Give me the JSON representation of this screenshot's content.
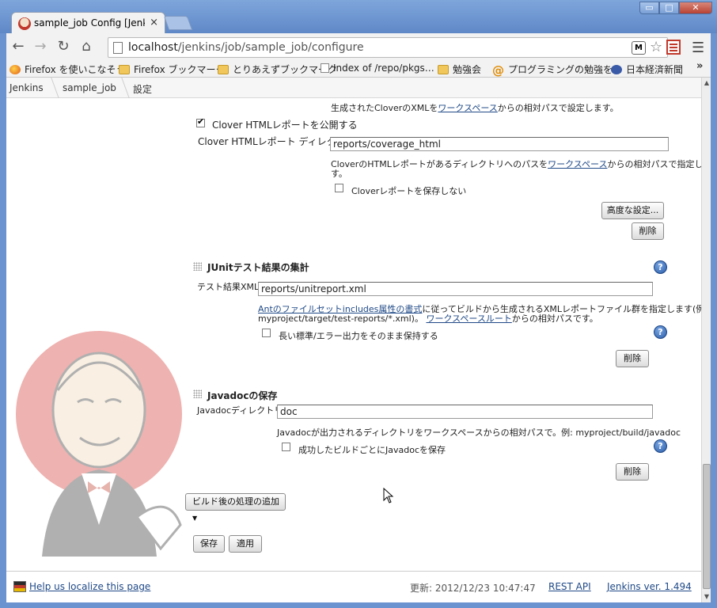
{
  "browser": {
    "tab_title": "sample_job Config [Jenkins]",
    "tab_close": "×",
    "url_prefix": "localhost",
    "url_path": "/jenkins/job/sample_job/configure",
    "ext_icon": "M",
    "back_icon": "←",
    "forward_icon": "→",
    "reload_icon": "↻",
    "home_icon": "⌂",
    "star_icon": "☆",
    "menu_icon": "☰",
    "window_min": "▭",
    "window_max": "□",
    "window_close": "✕",
    "bookmarks_more": "»",
    "bookmarks": [
      {
        "label": "Firefox を使いこなそう",
        "icon": "firefox-icon"
      },
      {
        "label": "Firefox ブックマーク",
        "icon": "folder-icon"
      },
      {
        "label": "とりあえずブックマーク",
        "icon": "folder-icon"
      },
      {
        "label": "Index of /repo/pkgs…",
        "icon": "page-icon"
      },
      {
        "label": "勉強会",
        "icon": "folder-icon"
      },
      {
        "label": "プログラミングの勉強を…",
        "icon": "at-icon"
      },
      {
        "label": "日本経済新聞",
        "icon": "nikkei-icon"
      }
    ]
  },
  "breadcrumbs": [
    "Jenkins",
    "sample_job",
    "設定"
  ],
  "clover": {
    "top_desc_1": "生成されたCloverのXMLを",
    "top_desc_link": "ワークスペース",
    "top_desc_2": "からの相対パスで設定します。",
    "publish_label": "Clover HTMLレポートを公開する",
    "publish_checked": true,
    "dir_label": "Clover HTMLレポート ディレクトリ",
    "dir_value": "reports/coverage_html",
    "dir_desc_1": "CloverのHTMLレポートがあるディレクトリへのパスを",
    "dir_desc_link": "ワークスペース",
    "dir_desc_2": "からの相対パスで指定しま",
    "dir_desc_3": "す。",
    "no_archive_label": "Cloverレポートを保存しない",
    "advanced_button": "高度な設定...",
    "delete_button": "削除"
  },
  "junit": {
    "title": "JUnitテスト結果の集計",
    "xml_label": "テスト結果XML",
    "xml_value": "reports/unitreport.xml",
    "desc_link1": "Antのファイルセットincludes属性の書式",
    "desc_1": "に従ってビルドから生成されるXMLレポートファイル群を指定します(例:",
    "desc_2": "myproject/target/test-reports/*.xml)。",
    "desc_link2": "ワークスペースルート",
    "desc_3": "からの相対パスです。",
    "retain_label": "長い標準/エラー出力をそのまま保持する",
    "delete_button": "削除"
  },
  "javadoc": {
    "title": "Javadocの保存",
    "dir_label": "Javadocディレクトリ",
    "dir_value": "doc",
    "desc": "Javadocが出力されるディレクトリをワークスペースからの相対パスで。例: myproject/build/javadoc",
    "keep_label": "成功したビルドごとにJavadocを保存",
    "delete_button": "削除"
  },
  "add_post_build_button": "ビルド後の処理の追加",
  "save_button": "保存",
  "apply_button": "適用",
  "help_glyph": "?",
  "footer": {
    "localize_link": "Help us localize this page",
    "updated": "更新: 2012/12/23 10:47:47",
    "rest_api": "REST API",
    "version": "Jenkins ver. 1.494"
  }
}
